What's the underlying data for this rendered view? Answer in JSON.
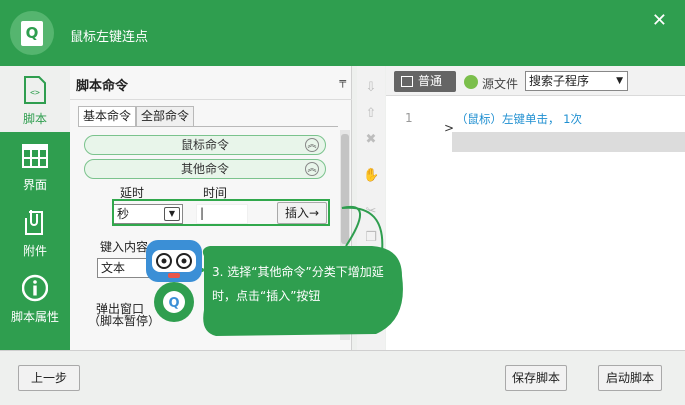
{
  "window": {
    "title": "鼠标左键连点",
    "logo_letter": "Q"
  },
  "nav": [
    {
      "label": "脚本",
      "icon": "code-file-icon",
      "active": true
    },
    {
      "label": "界面",
      "icon": "layout-grid-icon"
    },
    {
      "label": "附件",
      "icon": "attachment-icon"
    },
    {
      "label": "脚本属性",
      "icon": "info-icon"
    }
  ],
  "panel": {
    "title": "脚本命令",
    "tabs": [
      "基本命令",
      "全部命令"
    ],
    "categories": [
      "鼠标命令",
      "其他命令"
    ],
    "delay_label": "延时",
    "time_label": "时间",
    "unit_value": "秒",
    "time_value": "|",
    "insert_label": "插入→",
    "key_content_label": "键入内容",
    "text_type_value": "文本",
    "popup_label_1": "弹出窗口",
    "popup_label_2": "（脚本暂停）"
  },
  "editor": {
    "mode_normal": "普通",
    "mode_source": "源文件",
    "search_placeholder": "搜索子程序",
    "line_number": "1",
    "code_line": "（鼠标）左键单击， 1次"
  },
  "callout": {
    "text": "3. 选择“其他命令”分类下增加延时，点击“插入”按钮"
  },
  "footer": {
    "prev_label": "上一步",
    "save_label": "保存脚本",
    "start_label": "启动脚本"
  }
}
